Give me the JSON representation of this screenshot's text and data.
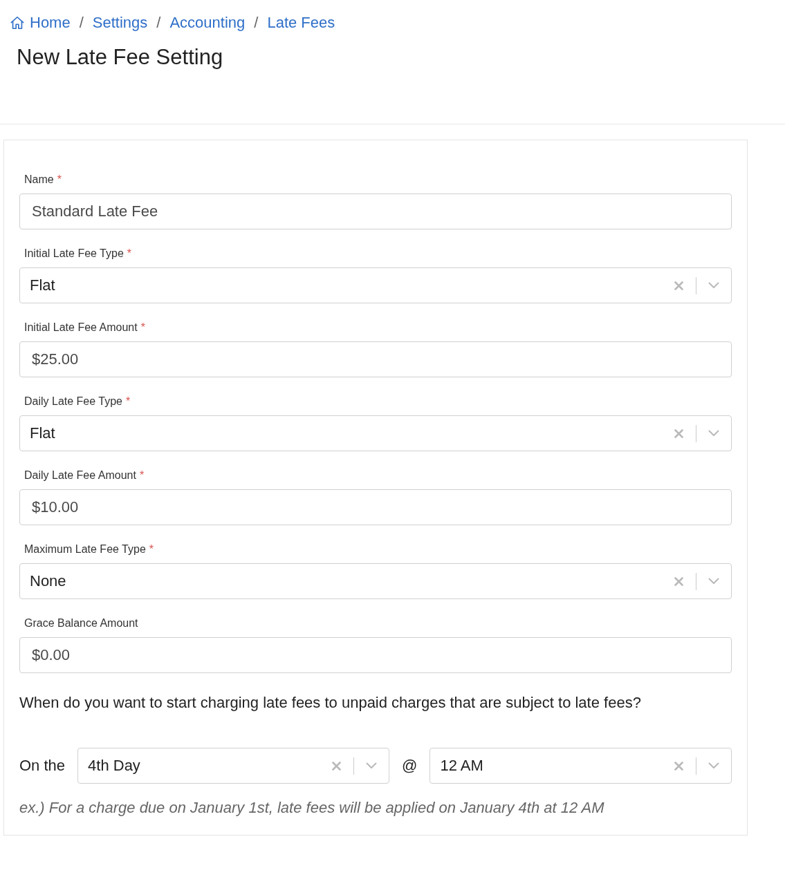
{
  "breadcrumb": [
    {
      "label": "Home"
    },
    {
      "separator": "/",
      "label": "Settings"
    },
    {
      "separator": "/",
      "label": "Accounting"
    },
    {
      "separator": "/",
      "label": "Late Fees"
    }
  ],
  "title": "New Late Fee Setting",
  "form": {
    "fields": [
      {
        "kind": "text",
        "label": "Name",
        "required_mark": "*",
        "value": "Standard Late Fee"
      },
      {
        "kind": "select",
        "label": "Initial Late Fee Type",
        "required_mark": "*",
        "value": "Flat"
      },
      {
        "kind": "text",
        "label": "Initial Late Fee Amount",
        "required_mark": "*",
        "value": "$25.00"
      },
      {
        "kind": "select",
        "label": "Daily Late Fee Type",
        "required_mark": "*",
        "value": "Flat"
      },
      {
        "kind": "text",
        "label": "Daily Late Fee Amount",
        "required_mark": "*",
        "value": "$10.00"
      },
      {
        "kind": "select",
        "label": "Maximum Late Fee Type",
        "required_mark": "*",
        "value": "None"
      },
      {
        "kind": "text",
        "label": "Grace Balance Amount",
        "value": "$0.00"
      }
    ],
    "question": "When do you want to start charging late fees to unpaid charges that are subject to late fees?",
    "schedule": {
      "prefix": "On the",
      "day_select": {
        "value": "4th Day"
      },
      "separator": "@",
      "time_select": {
        "value": "12 AM"
      }
    },
    "example": "ex.) For a charge due on January 1st, late fees will be applied on January 4th at 12 AM"
  }
}
